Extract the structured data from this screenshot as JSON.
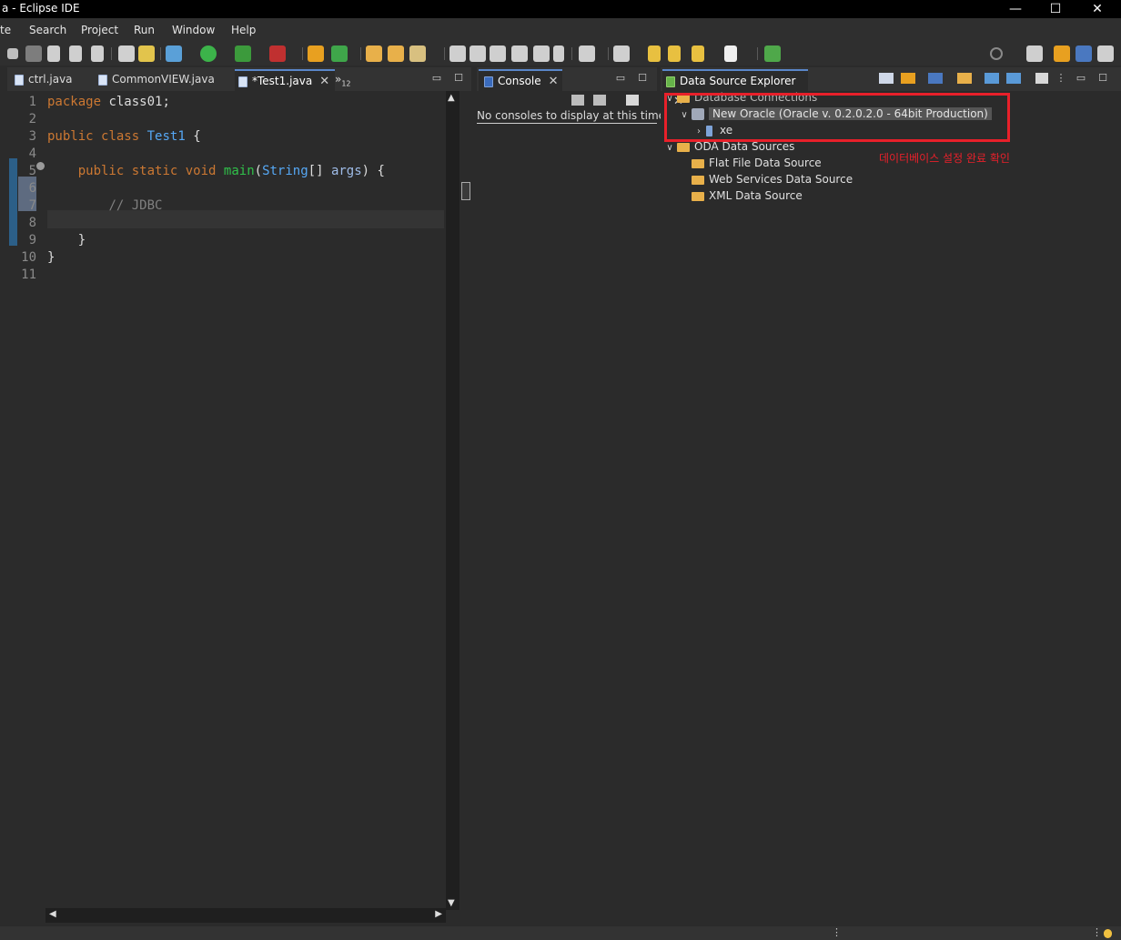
{
  "window": {
    "title": "a - Eclipse IDE",
    "minimize": "—",
    "maximize": "☐",
    "close": "✕"
  },
  "menu": [
    "te",
    "Search",
    "Project",
    "Run",
    "Window",
    "Help"
  ],
  "editor": {
    "tabs": [
      {
        "label": "ctrl.java",
        "active": false
      },
      {
        "label": "CommonVIEW.java",
        "active": false
      },
      {
        "label": "*Test1.java",
        "active": true
      }
    ],
    "overflow": "»",
    "overflow_count": "12",
    "lines": [
      {
        "n": "1",
        "parts": [
          [
            "kw",
            "package"
          ],
          [
            "plain",
            " class01;"
          ]
        ]
      },
      {
        "n": "2",
        "parts": []
      },
      {
        "n": "3",
        "parts": [
          [
            "kw",
            "public"
          ],
          [
            "plain",
            " "
          ],
          [
            "kw",
            "class"
          ],
          [
            "plain",
            " "
          ],
          [
            "cls",
            "Test1"
          ],
          [
            "plain",
            " {"
          ]
        ]
      },
      {
        "n": "4",
        "parts": []
      },
      {
        "n": "5",
        "parts": [
          [
            "plain",
            "    "
          ],
          [
            "kw",
            "public"
          ],
          [
            "plain",
            " "
          ],
          [
            "kw",
            "static"
          ],
          [
            "plain",
            " "
          ],
          [
            "kw",
            "void"
          ],
          [
            "plain",
            " "
          ],
          [
            "fn",
            "main"
          ],
          [
            "plain",
            "("
          ],
          [
            "cls",
            "String"
          ],
          [
            "plain",
            "[] "
          ],
          [
            "var",
            "args"
          ],
          [
            "plain",
            ") {"
          ]
        ]
      },
      {
        "n": "6",
        "parts": []
      },
      {
        "n": "7",
        "parts": [
          [
            "plain",
            "        "
          ],
          [
            "cmt",
            "// JDBC"
          ]
        ]
      },
      {
        "n": "8",
        "parts": []
      },
      {
        "n": "9",
        "parts": [
          [
            "plain",
            "    }"
          ]
        ]
      },
      {
        "n": "10",
        "parts": [
          [
            "plain",
            "}"
          ]
        ]
      },
      {
        "n": "11",
        "parts": []
      }
    ]
  },
  "console": {
    "tab_label": "Console",
    "message": "No consoles to display at this time."
  },
  "dse": {
    "tab_label": "Data Source Explorer",
    "tree": {
      "db_connections": "Database Connections",
      "new_oracle": "New Oracle (Oracle v. 0.2.0.2.0 - 64bit Production)",
      "xe": "xe",
      "oda_sources": "ODA Data Sources",
      "flat_file": "Flat File Data Source",
      "web_services": "Web Services Data Source",
      "xml_source": "XML Data Source"
    },
    "annotation": "데이터베이스 설정 완료 확인"
  },
  "colors": {
    "annotation_red": "#e8202a",
    "accent_blue": "#5a86c9"
  }
}
